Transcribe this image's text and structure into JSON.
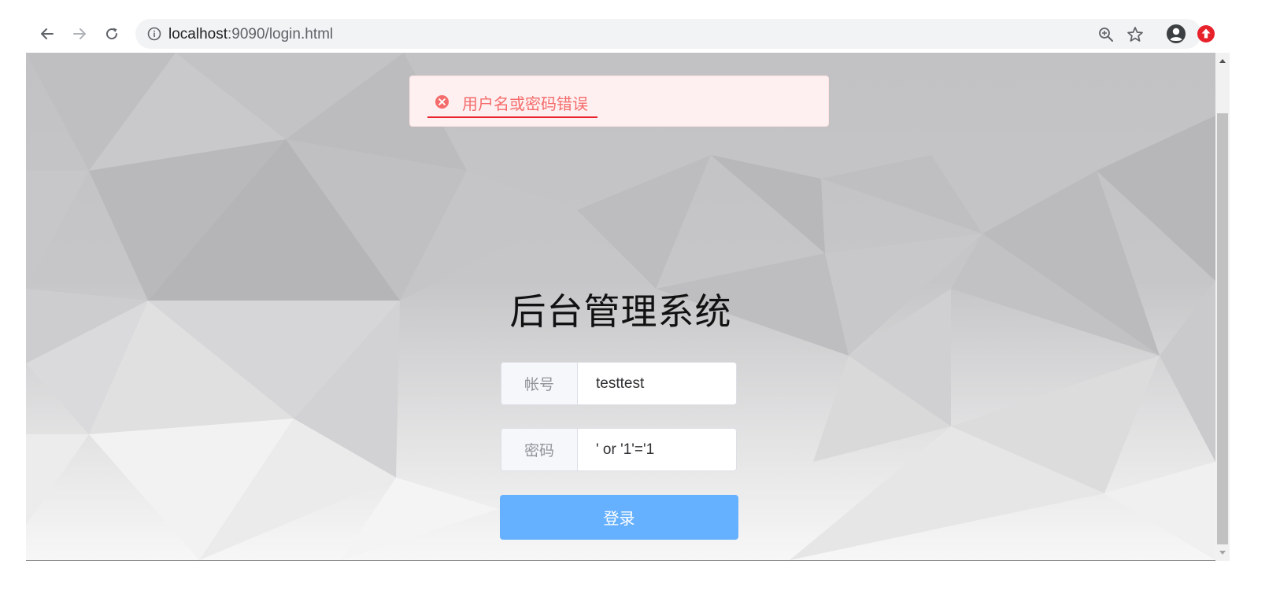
{
  "browser": {
    "url_host": "localhost",
    "url_path": ":9090/login.html",
    "icons": [
      "back-arrow-icon",
      "forward-arrow-icon",
      "reload-icon",
      "info-icon",
      "zoom-icon",
      "star-icon",
      "profile-icon",
      "extension-icon"
    ]
  },
  "alert": {
    "message": "用户名或密码错误",
    "type": "error"
  },
  "login": {
    "title": "后台管理系统",
    "username_label": "帐号",
    "username_value": "testtest",
    "password_label": "密码",
    "password_value": "' or '1'='1",
    "submit_label": "登录"
  },
  "colors": {
    "error": "#f56c6c",
    "error_bg": "#fef0f0",
    "primary_button": "#66b1ff"
  }
}
